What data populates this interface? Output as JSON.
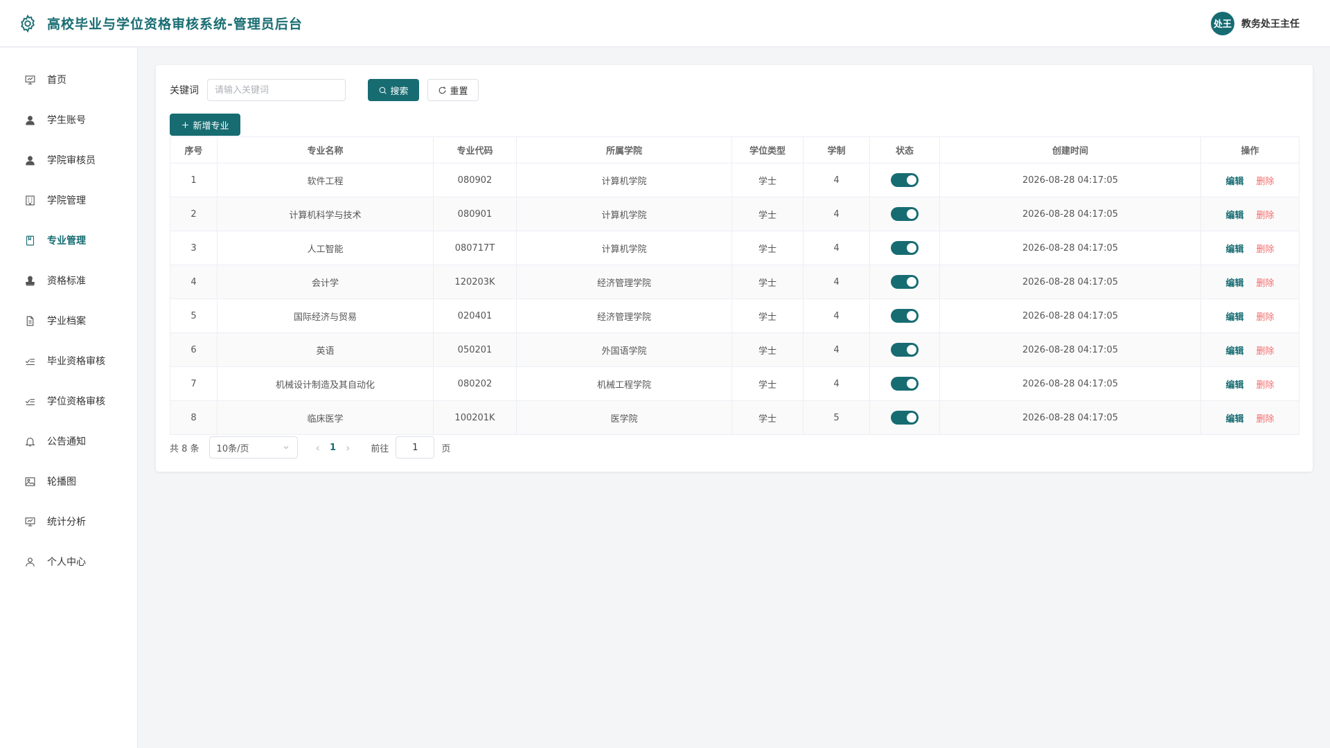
{
  "header": {
    "title": "高校毕业与学位资格审核系统-管理员后台",
    "user_name": "教务处王主任",
    "avatar_text": "处王"
  },
  "sidebar": {
    "items": [
      {
        "label": "首页",
        "icon": "dashboard-icon"
      },
      {
        "label": "学生账号",
        "icon": "user-icon"
      },
      {
        "label": "学院审核员",
        "icon": "user-icon"
      },
      {
        "label": "学院管理",
        "icon": "building-icon"
      },
      {
        "label": "专业管理",
        "icon": "book-icon",
        "active": true
      },
      {
        "label": "资格标准",
        "icon": "stamp-icon"
      },
      {
        "label": "学业档案",
        "icon": "document-icon"
      },
      {
        "label": "毕业资格审核",
        "icon": "checklist-icon"
      },
      {
        "label": "学位资格审核",
        "icon": "checklist-icon"
      },
      {
        "label": "公告通知",
        "icon": "bell-icon"
      },
      {
        "label": "轮播图",
        "icon": "image-icon"
      },
      {
        "label": "统计分析",
        "icon": "chart-icon"
      },
      {
        "label": "个人中心",
        "icon": "person-icon"
      }
    ]
  },
  "search": {
    "label": "关键词",
    "placeholder": "请输入关键词",
    "search_label": "搜索",
    "reset_label": "重置",
    "add_label": "新增专业"
  },
  "table": {
    "columns": [
      "序号",
      "专业名称",
      "专业代码",
      "所属学院",
      "学位类型",
      "学制",
      "状态",
      "创建时间",
      "操作"
    ],
    "edit_label": "编辑",
    "delete_label": "删除",
    "rows": [
      {
        "no": "1",
        "name": "软件工程",
        "code": "080902",
        "college": "计算机学院",
        "degree": "学士",
        "years": "4",
        "enabled": true,
        "created": "2026-08-28 04:17:05"
      },
      {
        "no": "2",
        "name": "计算机科学与技术",
        "code": "080901",
        "college": "计算机学院",
        "degree": "学士",
        "years": "4",
        "enabled": true,
        "created": "2026-08-28 04:17:05"
      },
      {
        "no": "3",
        "name": "人工智能",
        "code": "080717T",
        "college": "计算机学院",
        "degree": "学士",
        "years": "4",
        "enabled": true,
        "created": "2026-08-28 04:17:05"
      },
      {
        "no": "4",
        "name": "会计学",
        "code": "120203K",
        "college": "经济管理学院",
        "degree": "学士",
        "years": "4",
        "enabled": true,
        "created": "2026-08-28 04:17:05"
      },
      {
        "no": "5",
        "name": "国际经济与贸易",
        "code": "020401",
        "college": "经济管理学院",
        "degree": "学士",
        "years": "4",
        "enabled": true,
        "created": "2026-08-28 04:17:05"
      },
      {
        "no": "6",
        "name": "英语",
        "code": "050201",
        "college": "外国语学院",
        "degree": "学士",
        "years": "4",
        "enabled": true,
        "created": "2026-08-28 04:17:05"
      },
      {
        "no": "7",
        "name": "机械设计制造及其自动化",
        "code": "080202",
        "college": "机械工程学院",
        "degree": "学士",
        "years": "4",
        "enabled": true,
        "created": "2026-08-28 04:17:05"
      },
      {
        "no": "8",
        "name": "临床医学",
        "code": "100201K",
        "college": "医学院",
        "degree": "学士",
        "years": "5",
        "enabled": true,
        "created": "2026-08-28 04:17:05"
      }
    ]
  },
  "pagination": {
    "total_text": "共 8 条",
    "page_size": "10条/页",
    "current_page": "1",
    "goto_label": "前往",
    "goto_value": "1",
    "goto_suffix": "页"
  },
  "colors": {
    "primary": "#176c72",
    "danger": "#f56c6c"
  }
}
